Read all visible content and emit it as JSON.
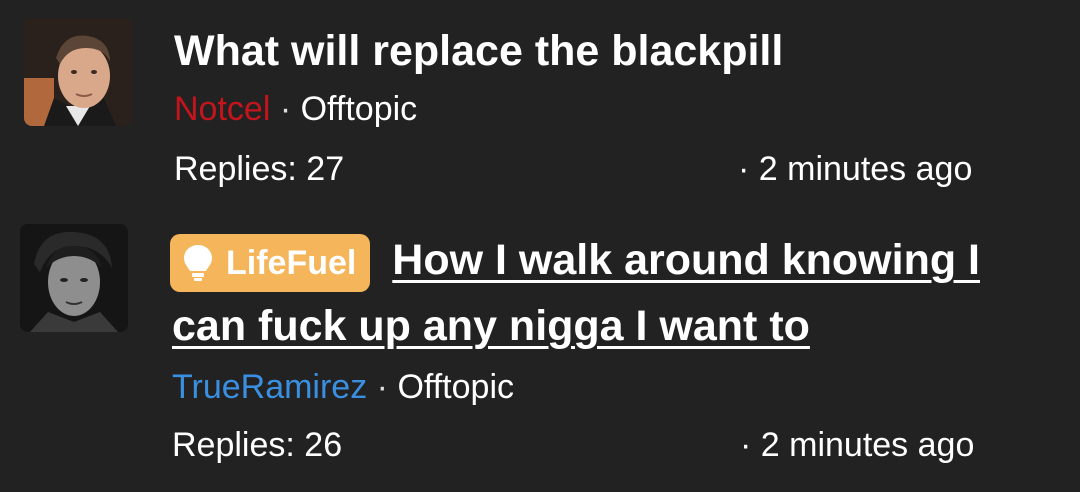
{
  "threads": [
    {
      "title": "What will replace the blackpill",
      "author": "Notcel",
      "author_color": "#c4151c",
      "separator": "·",
      "forum": "Offtopic",
      "replies": "Replies: 27",
      "time": "· 2 minutes ago"
    },
    {
      "prefix": "LifeFuel",
      "prefix_color": "#f5b55a",
      "prefix_icon": "lightbulb-icon",
      "title_line1": "How I walk around knowing I",
      "title_line2": "can fuck up any nigga I want to",
      "author": "TrueRamirez",
      "author_color": "#3a8fe0",
      "separator": "·",
      "forum": "Offtopic",
      "replies": "Replies: 26",
      "time": "· 2 minutes ago"
    }
  ]
}
